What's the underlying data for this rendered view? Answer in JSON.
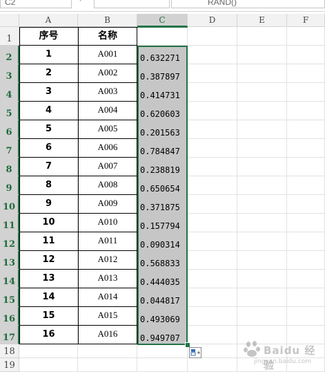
{
  "formula_bar": {
    "name_box": "C2",
    "formula": "RAND()"
  },
  "columns": [
    "A",
    "B",
    "C",
    "D",
    "E",
    "F"
  ],
  "selected_column": "C",
  "rows": [
    "1",
    "2",
    "3",
    "4",
    "5",
    "6",
    "7",
    "8",
    "9",
    "10",
    "11",
    "12",
    "13",
    "14",
    "15",
    "16",
    "17",
    "18",
    "19"
  ],
  "table": {
    "headers": {
      "seq": "序号",
      "name": "名称"
    },
    "records": [
      {
        "seq": "1",
        "name": "A001",
        "rand": "0.632271"
      },
      {
        "seq": "2",
        "name": "A002",
        "rand": "0.387897"
      },
      {
        "seq": "3",
        "name": "A003",
        "rand": "0.414731"
      },
      {
        "seq": "4",
        "name": "A004",
        "rand": "0.620603"
      },
      {
        "seq": "5",
        "name": "A005",
        "rand": "0.201563"
      },
      {
        "seq": "6",
        "name": "A006",
        "rand": "0.784847"
      },
      {
        "seq": "7",
        "name": "A007",
        "rand": "0.238819"
      },
      {
        "seq": "8",
        "name": "A008",
        "rand": "0.650654"
      },
      {
        "seq": "9",
        "name": "A009",
        "rand": "0.371875"
      },
      {
        "seq": "10",
        "name": "A010",
        "rand": "0.157794"
      },
      {
        "seq": "11",
        "name": "A011",
        "rand": "0.090314"
      },
      {
        "seq": "12",
        "name": "A012",
        "rand": "0.568833"
      },
      {
        "seq": "13",
        "name": "A013",
        "rand": "0.444035"
      },
      {
        "seq": "14",
        "name": "A014",
        "rand": "0.044817"
      },
      {
        "seq": "15",
        "name": "A015",
        "rand": "0.493069"
      },
      {
        "seq": "16",
        "name": "A016",
        "rand": "0.949707"
      }
    ]
  },
  "colors": {
    "selection": "#217346",
    "selected_fill": "#c6c6c6",
    "header_bg": "#f2f2f2"
  },
  "icons": {
    "quick_fill": "auto-fill-options-icon",
    "watermark": "baidu-jingyan-logo"
  },
  "watermark": {
    "text": "Baidu 经验",
    "url": "jingyan.baidu.com"
  }
}
